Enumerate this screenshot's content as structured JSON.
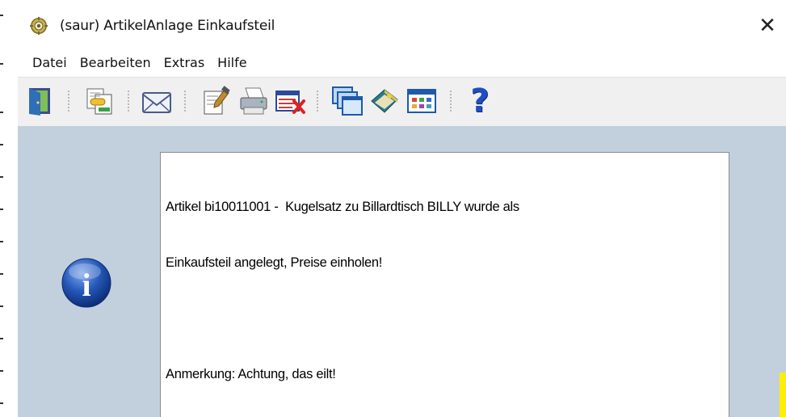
{
  "window": {
    "title": "(saur) ArtikelAnlage Einkaufsteil",
    "close_symbol": "✕",
    "app_icon": "gear-icon"
  },
  "menu": {
    "items": [
      "Datei",
      "Bearbeiten",
      "Extras",
      "Hilfe"
    ]
  },
  "toolbar": {
    "buttons": [
      {
        "icon": "exit-door-icon"
      },
      {
        "icon": "copy-link-icon"
      },
      {
        "icon": "mail-envelope-icon"
      },
      {
        "icon": "edit-document-icon"
      },
      {
        "icon": "printer-icon"
      },
      {
        "icon": "delete-list-icon"
      },
      {
        "icon": "windows-cascade-icon"
      },
      {
        "icon": "book-icon"
      },
      {
        "icon": "table-grid-icon"
      },
      {
        "icon": "help-question-icon"
      }
    ],
    "help_symbol": "?"
  },
  "message": {
    "line1": "Artikel bi10011001 -  Kugelsatz zu Billardtisch BILLY wurde als",
    "line2": "Einkaufsteil angelegt, Preise einholen!",
    "line3": "",
    "line4": "Anmerkung: Achtung, das eilt!"
  },
  "info_icon": {
    "symbol": "i"
  },
  "colors": {
    "content_background": "#c2d0de",
    "toolbar_background": "#f0f0f0",
    "info_blue": "#1f4fa8"
  }
}
